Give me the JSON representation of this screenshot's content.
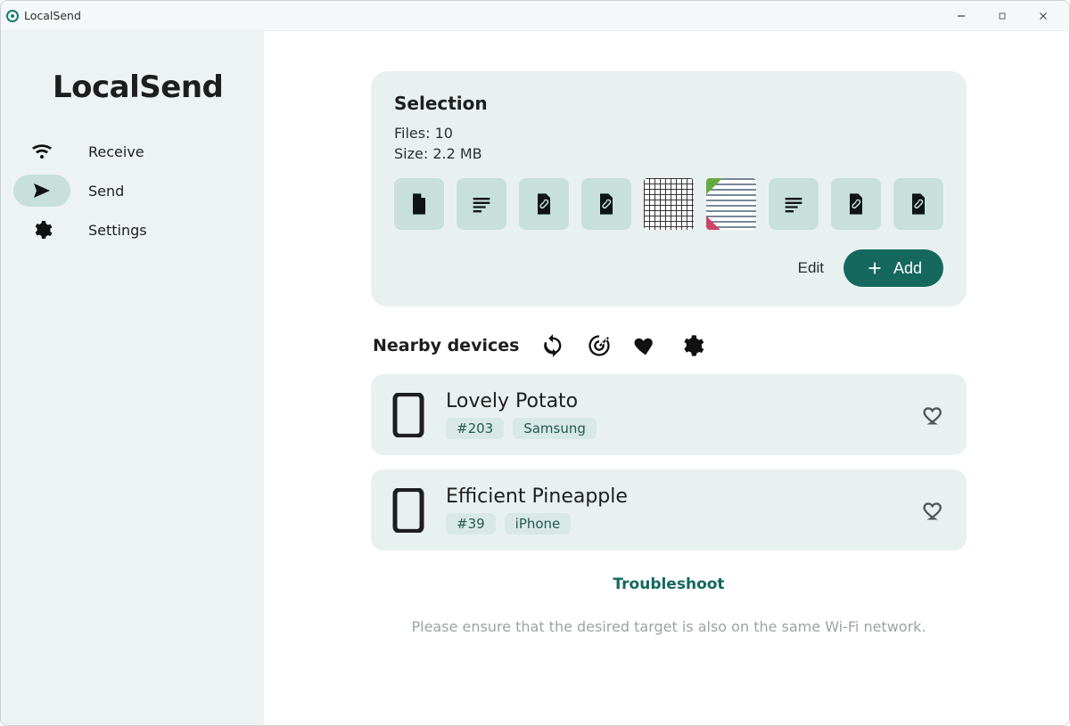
{
  "window": {
    "title": "LocalSend"
  },
  "sidebar": {
    "logo": "LocalSend",
    "items": [
      {
        "label": "Receive",
        "icon": "wifi",
        "active": false
      },
      {
        "label": "Send",
        "icon": "send",
        "active": true
      },
      {
        "label": "Settings",
        "icon": "gear",
        "active": false
      }
    ]
  },
  "selection": {
    "title": "Selection",
    "files_label": "Files: 10",
    "size_label": "Size: 2.2 MB",
    "thumbs": [
      "file",
      "text",
      "attach",
      "attach",
      "image-bw",
      "image-color",
      "text",
      "attach",
      "attach"
    ],
    "edit_label": "Edit",
    "add_label": "Add"
  },
  "nearby": {
    "title": "Nearby devices",
    "devices": [
      {
        "name": "Lovely Potato",
        "tag": "#203",
        "model": "Samsung"
      },
      {
        "name": "Efficient Pineapple",
        "tag": "#39",
        "model": "iPhone"
      }
    ]
  },
  "footer": {
    "troubleshoot": "Troubleshoot",
    "hint": "Please ensure that the desired target is also on the same Wi-Fi network."
  }
}
